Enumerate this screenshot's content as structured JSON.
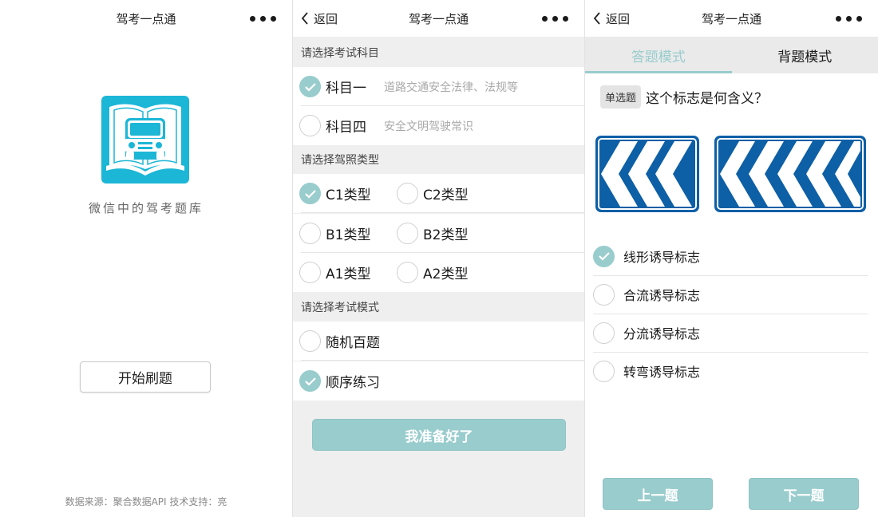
{
  "splash": {
    "title": "驾考一点通",
    "slogan": "微信中的驾考题库",
    "start_button": "开始刷题",
    "footer": "数据来源：聚合数据API 技术支持：亮",
    "logo_color": "#1cb6d6"
  },
  "setup": {
    "back_label": "返回",
    "title": "驾考一点通",
    "sections": [
      {
        "header": "请选择考试科目"
      },
      {
        "header": "请选择驾照类型"
      },
      {
        "header": "请选择考试模式"
      }
    ],
    "subjects": [
      {
        "label": "科目一",
        "desc": "道路交通安全法律、法规等",
        "selected": true
      },
      {
        "label": "科目四",
        "desc": "安全文明驾驶常识",
        "selected": false
      }
    ],
    "license_types": [
      {
        "label": "C1类型",
        "selected": true
      },
      {
        "label": "C2类型",
        "selected": false
      },
      {
        "label": "B1类型",
        "selected": false
      },
      {
        "label": "B2类型",
        "selected": false
      },
      {
        "label": "A1类型",
        "selected": false
      },
      {
        "label": "A2类型",
        "selected": false
      }
    ],
    "modes": [
      {
        "label": "随机百题",
        "selected": false
      },
      {
        "label": "顺序练习",
        "selected": true
      }
    ],
    "ready_button": "我准备好了"
  },
  "quiz": {
    "back_label": "返回",
    "title": "驾考一点通",
    "tabs": [
      {
        "label": "答题模式",
        "active": true
      },
      {
        "label": "背题模式",
        "active": false
      }
    ],
    "question_type": "单选题",
    "question_text": "这个标志是何含义？",
    "answers": [
      {
        "label": "线形诱导标志",
        "selected": true
      },
      {
        "label": "合流诱导标志",
        "selected": false
      },
      {
        "label": "分流诱导标志",
        "selected": false
      },
      {
        "label": "转弯诱导标志",
        "selected": false
      }
    ],
    "prev_button": "上一题",
    "next_button": "下一题"
  },
  "colors": {
    "accent": "#99cccd",
    "sign_blue": "#0d5fa6",
    "section_bg": "#efefef"
  }
}
